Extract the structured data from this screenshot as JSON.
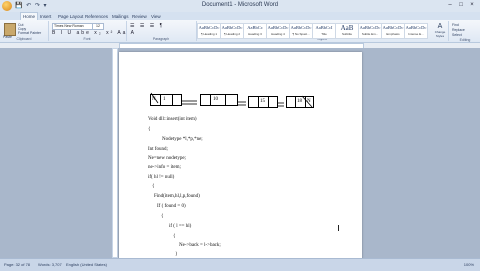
{
  "window": {
    "title": "Document1 - Microsoft Word",
    "qat": "💾 ↶ ↷ ▾"
  },
  "tabs": [
    "Home",
    "Insert",
    "Page Layout",
    "References",
    "Mailings",
    "Review",
    "View"
  ],
  "ribbon": {
    "clipboard": {
      "label": "Clipboard",
      "paste": "Paste",
      "cut": "Cut",
      "copy": "Copy",
      "painter": "Format Painter"
    },
    "font": {
      "label": "Font",
      "name": "Times New Roman",
      "size": "12",
      "fmt": "B I U abe x₂ x² Aa A"
    },
    "paragraph": {
      "label": "Paragraph",
      "row": "☰ ☰ ☰ ¶"
    },
    "styles": {
      "label": "Styles",
      "items": [
        {
          "sample": "AaBbCcDc",
          "name": "¶ Heading 1"
        },
        {
          "sample": "AaBbCcDc",
          "name": "¶ Heading 2"
        },
        {
          "sample": "AaBbCc",
          "name": "Heading 3"
        },
        {
          "sample": "AaBbCcDc",
          "name": "Heading 4"
        },
        {
          "sample": "AaBbCcDc",
          "name": "¶ No Spaci..."
        },
        {
          "sample": "AaBbCcI",
          "name": "Title"
        },
        {
          "sample": "AaB",
          "name": "Subtitle"
        },
        {
          "sample": "AaBbCcDc",
          "name": "Subtle Em..."
        },
        {
          "sample": "AaBbCcDc",
          "name": "Emphasis"
        },
        {
          "sample": "AaBbCcDc",
          "name": "Intense E..."
        }
      ],
      "change": "Change Styles"
    },
    "editing": {
      "label": "Editing",
      "find": "Find",
      "replace": "Replace",
      "select": "Select"
    }
  },
  "document": {
    "list_nodes": [
      {
        "values": [
          "N",
          "1",
          ""
        ]
      },
      {
        "values": [
          "",
          "10",
          ""
        ]
      },
      {
        "values": [
          "",
          "15",
          ""
        ]
      },
      {
        "values": [
          "",
          "18",
          "N"
        ]
      }
    ],
    "code_lines": [
      "Void dll::insert(int item)",
      "{",
      "Nodetype *l,*p,*ne;",
      "Int found;",
      "Ne=new nodetype;",
      "ne->info = item;",
      "if( hl != null)",
      "{",
      "Find(item,hl,l,p,found)",
      "If ( found = 0)",
      "{",
      "if ( l == hl)",
      "{",
      "Ne->back = l->back;",
      "}"
    ]
  },
  "status": {
    "page": "Page: 32 of 78",
    "words": "Words: 3,707",
    "lang": "English (United States)",
    "zoom": "100%"
  }
}
